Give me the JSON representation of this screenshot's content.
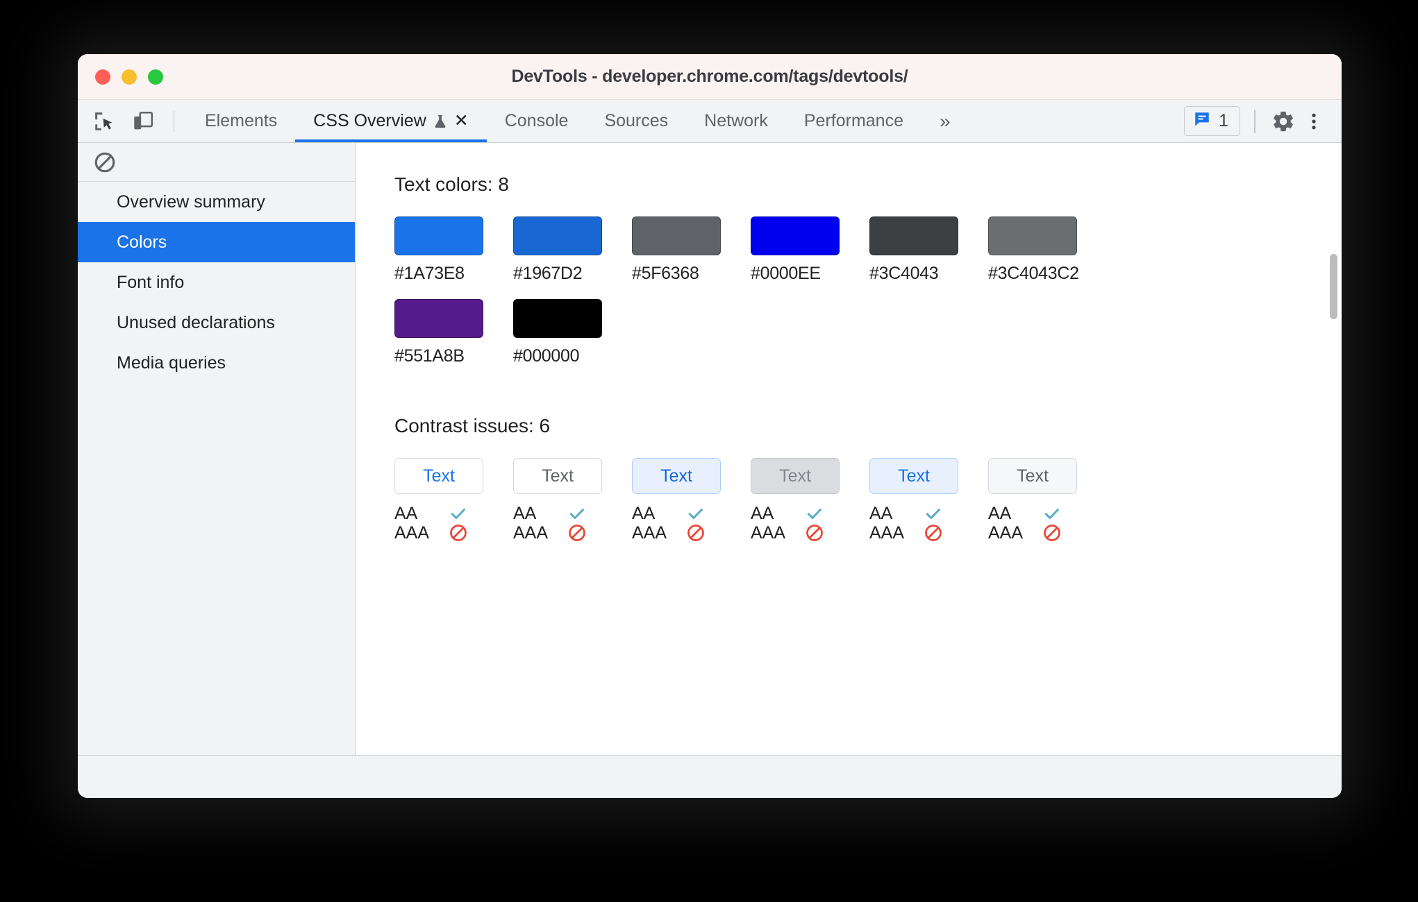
{
  "window": {
    "title": "DevTools - developer.chrome.com/tags/devtools/",
    "traffic_lights": [
      "close",
      "minimize",
      "zoom"
    ]
  },
  "toolbar": {
    "inspect_icon": "inspect-cursor-icon",
    "device_icon": "device-toolbar-icon",
    "overflow_label": "»",
    "message_count": "1",
    "message_icon": "message-bubble-icon",
    "settings_icon": "gear-icon",
    "more_icon": "kebab-menu-icon"
  },
  "tabs": [
    {
      "label": "Elements",
      "active": false,
      "experimental": false,
      "closeable": false
    },
    {
      "label": "CSS Overview",
      "active": true,
      "experimental": true,
      "closeable": true,
      "close_label": "✕"
    },
    {
      "label": "Console",
      "active": false,
      "experimental": false,
      "closeable": false
    },
    {
      "label": "Sources",
      "active": false,
      "experimental": false,
      "closeable": false
    },
    {
      "label": "Network",
      "active": false,
      "experimental": false,
      "closeable": false
    },
    {
      "label": "Performance",
      "active": false,
      "experimental": false,
      "closeable": false
    }
  ],
  "sidebar": {
    "clear_icon": "block-clear-icon",
    "items": [
      {
        "label": "Overview summary",
        "selected": false
      },
      {
        "label": "Colors",
        "selected": true
      },
      {
        "label": "Font info",
        "selected": false
      },
      {
        "label": "Unused declarations",
        "selected": false
      },
      {
        "label": "Media queries",
        "selected": false
      }
    ]
  },
  "main": {
    "text_colors": {
      "heading": "Text colors: 8",
      "count": 8,
      "swatches": [
        {
          "label": "#1A73E8",
          "color": "#1A73E8"
        },
        {
          "label": "#1967D2",
          "color": "#1967D2"
        },
        {
          "label": "#5F6368",
          "color": "#5F6368"
        },
        {
          "label": "#0000EE",
          "color": "#0000EE"
        },
        {
          "label": "#3C4043",
          "color": "#3C4043"
        },
        {
          "label": "#3C4043C2",
          "color": "#3C4043C2"
        },
        {
          "label": "#551A8B",
          "color": "#551A8B"
        },
        {
          "label": "#000000",
          "color": "#000000"
        }
      ]
    },
    "contrast_issues": {
      "heading": "Contrast issues: 6",
      "count": 6,
      "aa_label": "AA",
      "aaa_label": "AAA",
      "pass_icon": "check-icon",
      "fail_icon": "block-icon",
      "pass_color": "#5badc4",
      "fail_color": "#ea4335",
      "items": [
        {
          "text": "Text",
          "fg": "#1a73e8",
          "bg": "#ffffff",
          "border": "#d2d5d9",
          "aa": "pass",
          "aaa": "fail"
        },
        {
          "text": "Text",
          "fg": "#5f6368",
          "bg": "#ffffff",
          "border": "#d2d5d9",
          "aa": "pass",
          "aaa": "fail"
        },
        {
          "text": "Text",
          "fg": "#1967d2",
          "bg": "#e8f0fe",
          "border": "#aecbfa",
          "aa": "pass",
          "aaa": "fail"
        },
        {
          "text": "Text",
          "fg": "#80868b",
          "bg": "#dadce0",
          "border": "#c4c7ca",
          "aa": "pass",
          "aaa": "fail"
        },
        {
          "text": "Text",
          "fg": "#1a73e8",
          "bg": "#e8f0fe",
          "border": "#aecbfa",
          "aa": "pass",
          "aaa": "fail"
        },
        {
          "text": "Text",
          "fg": "#5f6368",
          "bg": "#f6f7f8",
          "border": "#d2d5d9",
          "aa": "pass",
          "aaa": "fail"
        }
      ]
    }
  },
  "scrollbar": {
    "thumb_color": "#bcbcbc"
  },
  "colors": {
    "accent": "#1a73e8",
    "titlebar_bg": "#faf3f1",
    "chrome_bg": "#f1f3f4",
    "panel_bg": "#ffffff"
  }
}
